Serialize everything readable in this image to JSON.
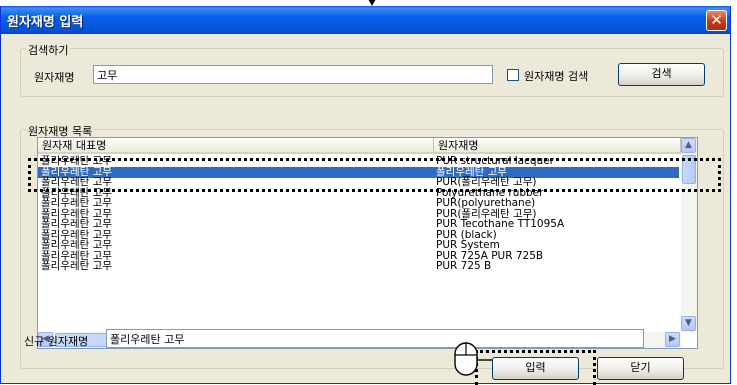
{
  "window": {
    "title": "원자재명 입력",
    "close_icon": "close-icon"
  },
  "search_group": {
    "legend": "검색하기",
    "label": "원자재명",
    "input_value": "고무",
    "checkbox_label": "원자재명 검색",
    "search_button": "검색"
  },
  "list_group": {
    "legend": "원자재명 목록",
    "columns": [
      "원자재 대표명",
      "원자재명"
    ],
    "rows": [
      [
        "폴리우레탄 고무",
        "PUR structural lacquer"
      ],
      [
        "폴리우레탄 고무",
        "폴리우레탄 고무"
      ],
      [
        "폴리우레탄 고무",
        "PUR(폴리우레탄 고무)"
      ],
      [
        "폴리우레탄 고무",
        "Polyurethane rubber"
      ],
      [
        "폴리우레탄 고무",
        "PUR(polyurethane)"
      ],
      [
        "폴리우레탄 고무",
        "PUR(폴리우레탄 고무)"
      ],
      [
        "폴리우레탄 고무",
        "PUR Tecothane TT1095A"
      ],
      [
        "폴리우레탄 고무",
        "PUR (black)"
      ],
      [
        "폴리우레탄 고무",
        "PUR System"
      ],
      [
        "폴리우레탄 고무",
        "PUR 725A PUR 725B"
      ],
      [
        "폴리우레탄 고무",
        "PUR 725 B"
      ]
    ],
    "selected_row": 1
  },
  "new_material": {
    "label": "신규 원자재명",
    "input_value": "폴리우레탄 고무"
  },
  "buttons": {
    "enter": "입력",
    "close": "닫기"
  },
  "colors": {
    "titlebar": "#0a5fe6",
    "selection": "#316ac5",
    "window_bg": "#ece9d8"
  }
}
